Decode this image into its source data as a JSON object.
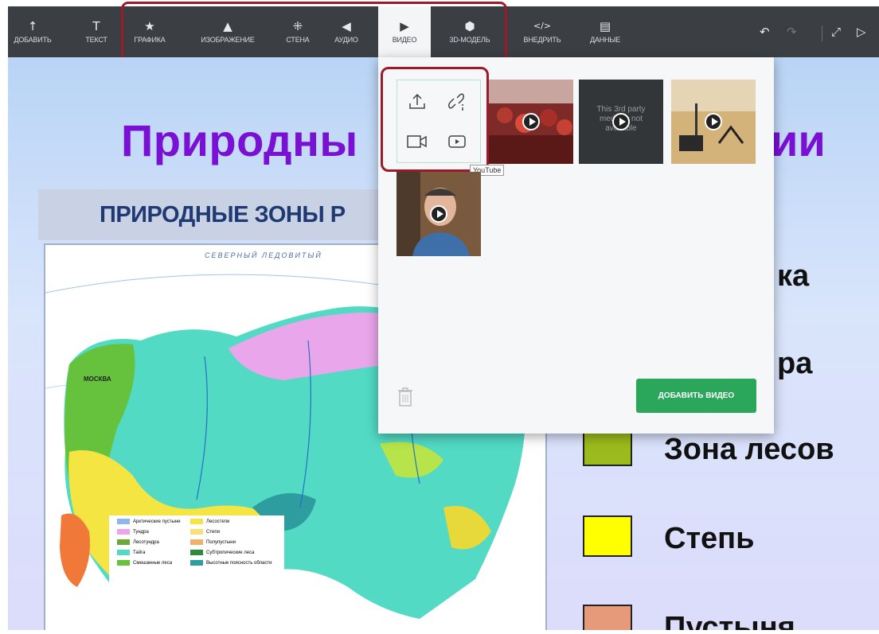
{
  "toolbar": {
    "items": [
      {
        "label": "ДОБАВИТЬ",
        "icon": "↑"
      },
      {
        "label": "ТЕКСТ",
        "icon": "T"
      },
      {
        "label": "ГРАФИКА",
        "icon": "★"
      },
      {
        "label": "ИЗОБРАЖЕНИЕ",
        "icon": "▲"
      },
      {
        "label": "СТЕНА",
        "icon": "⁜"
      },
      {
        "label": "АУДИО",
        "icon": "◀"
      },
      {
        "label": "ВИДЕО",
        "icon": "▶"
      },
      {
        "label": "3D-МОДЕЛЬ",
        "icon": "⬢"
      },
      {
        "label": "ВНЕДРИТЬ",
        "icon": "</>"
      },
      {
        "label": "ДАННЫЕ",
        "icon": "▤"
      }
    ],
    "undo_icon": "↶",
    "redo_icon": "↷",
    "expand_icon": "⤢",
    "play_icon": "▷"
  },
  "slide": {
    "title_visible": "Природны",
    "title_end": "ии",
    "subtitle": "ПРИРОДНЫЕ ЗОНЫ Р",
    "legend": [
      {
        "text": "ка",
        "color": ""
      },
      {
        "text": "ра",
        "color": ""
      },
      {
        "text": "Зона лесов",
        "color": "#9bbb1c"
      },
      {
        "text": "Степь",
        "color": "#ffff00"
      },
      {
        "text": "Пустыня",
        "color": "#e79a7a"
      }
    ]
  },
  "map": {
    "top_label": "СЕВЕРНЫЙ ЛЕДОВИТЫЙ",
    "city": "МОСКВА",
    "legend_items": [
      "Арктические пустыни",
      "Тундра",
      "Лесотундра",
      "Тайга",
      "Смешанные леса",
      "Лесостепи",
      "Степи",
      "Полупустыни",
      "Субтропические леса",
      "Высотные поясность области"
    ]
  },
  "video_popup": {
    "tooltip": "YouTube",
    "thumbnails": [
      {
        "caption": ""
      },
      {
        "caption": "This 3rd party media is not available"
      },
      {
        "caption": ""
      },
      {
        "caption": ""
      }
    ],
    "add_button": "ДОБАВИТЬ ВИДЕО"
  },
  "colors": {
    "accent_green": "#2aa75a",
    "toolbar_bg": "#3b3f44",
    "highlight_frame": "#9b1b2a",
    "title_purple": "#7a10d4"
  }
}
